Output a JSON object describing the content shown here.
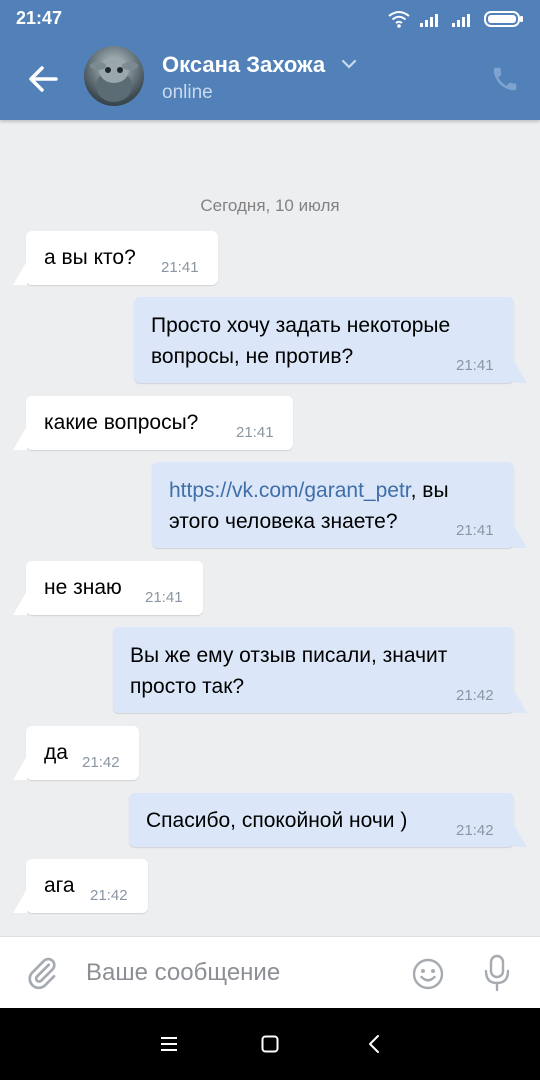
{
  "status_bar": {
    "time": "21:47"
  },
  "header": {
    "contact_name": "Оксана Захожа",
    "status": "online"
  },
  "chat": {
    "date_separator": "Сегодня, 10 июля",
    "messages": [
      {
        "dir": "in",
        "text": "а вы кто?",
        "time": "21:41"
      },
      {
        "dir": "out",
        "line1": "Просто хочу задать некоторые",
        "line2": "вопросы, не против?",
        "time": "21:41"
      },
      {
        "dir": "in",
        "text": "какие вопросы?",
        "time": "21:41"
      },
      {
        "dir": "out",
        "link": "https://vk.com/garant_petr",
        "line1_rest": ", вы",
        "line2": "этого человека знаете?",
        "time": "21:41"
      },
      {
        "dir": "in",
        "text": "не знаю",
        "time": "21:41"
      },
      {
        "dir": "out",
        "line1": "Вы же ему отзыв писали, значит",
        "line2": "просто так?",
        "time": "21:42"
      },
      {
        "dir": "in",
        "text": "да",
        "time": "21:42"
      },
      {
        "dir": "out",
        "text": "Спасибо, спокойной ночи )",
        "time": "21:42"
      },
      {
        "dir": "in",
        "text": "ага",
        "time": "21:42"
      }
    ]
  },
  "composer": {
    "placeholder": "Ваше сообщение"
  },
  "colors": {
    "header": "#5181b8",
    "background": "#edeef0",
    "incoming": "#ffffff",
    "outgoing": "#dbe7f8",
    "link": "#3f6ea8"
  },
  "icons": [
    "back-arrow-icon",
    "chevron-down-icon",
    "phone-icon",
    "wifi-icon",
    "signal-icon",
    "battery-icon",
    "paperclip-icon",
    "emoji-icon",
    "microphone-icon",
    "menu-icon",
    "home-icon",
    "back-nav-icon"
  ]
}
